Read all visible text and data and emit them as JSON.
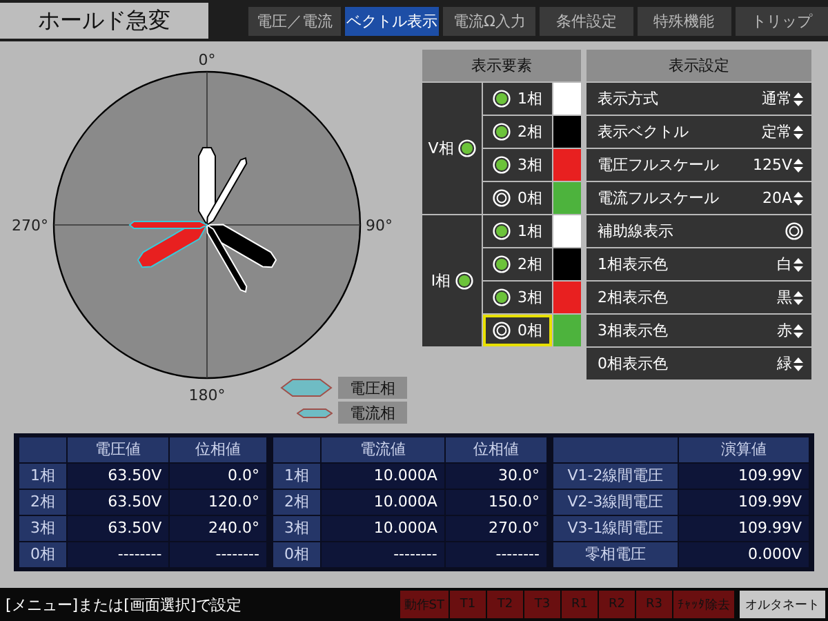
{
  "title": "ホールド急変",
  "tabs": [
    {
      "label": "電圧／電流",
      "selected": false
    },
    {
      "label": "ベクトル表示",
      "selected": true
    },
    {
      "label": "電流Ω入力",
      "selected": false
    },
    {
      "label": "条件設定",
      "selected": false
    },
    {
      "label": "特殊機能",
      "selected": false
    },
    {
      "label": "トリップ",
      "selected": false
    }
  ],
  "diagram": {
    "angle_labels": [
      "0°",
      "90°",
      "180°",
      "270°"
    ]
  },
  "legend": [
    {
      "label": "電圧相",
      "kind": "voltage"
    },
    {
      "label": "電流相",
      "kind": "current"
    }
  ],
  "display_elements": {
    "title": "表示要素",
    "groups": [
      {
        "label": "V相",
        "kind": "voltage",
        "on": true,
        "phases": [
          {
            "label": "1相",
            "on": true,
            "color": "#ffffff",
            "focused": false
          },
          {
            "label": "2相",
            "on": true,
            "color": "#000000",
            "focused": false
          },
          {
            "label": "3相",
            "on": true,
            "color": "#e82020",
            "focused": false
          },
          {
            "label": "0相",
            "on": false,
            "color": "#4db33d",
            "focused": false
          }
        ]
      },
      {
        "label": "I相",
        "kind": "current",
        "on": true,
        "phases": [
          {
            "label": "1相",
            "on": true,
            "color": "#ffffff",
            "focused": false
          },
          {
            "label": "2相",
            "on": true,
            "color": "#000000",
            "focused": false
          },
          {
            "label": "3相",
            "on": true,
            "color": "#e82020",
            "focused": false
          },
          {
            "label": "0相",
            "on": false,
            "color": "#4db33d",
            "focused": true
          }
        ]
      }
    ]
  },
  "display_settings": {
    "title": "表示設定",
    "rows": [
      {
        "label": "表示方式",
        "kind": "select",
        "value": "通常"
      },
      {
        "label": "表示ベクトル",
        "kind": "select",
        "value": "定常"
      },
      {
        "label": "電圧フルスケール",
        "kind": "select",
        "value": "125V"
      },
      {
        "label": "電流フルスケール",
        "kind": "select",
        "value": "20A"
      },
      {
        "label": "補助線表示",
        "kind": "toggle",
        "on": false
      },
      {
        "label": "1相表示色",
        "kind": "select",
        "value": "白"
      },
      {
        "label": "2相表示色",
        "kind": "select",
        "value": "黒"
      },
      {
        "label": "3相表示色",
        "kind": "select",
        "value": "赤"
      },
      {
        "label": "0相表示色",
        "kind": "select",
        "value": "緑"
      }
    ]
  },
  "voltage_table": {
    "columns": [
      "電圧値",
      "位相値"
    ],
    "rows": [
      {
        "label": "1相",
        "values": [
          "63.50V",
          "0.0°"
        ]
      },
      {
        "label": "2相",
        "values": [
          "63.50V",
          "120.0°"
        ]
      },
      {
        "label": "3相",
        "values": [
          "63.50V",
          "240.0°"
        ]
      },
      {
        "label": "0相",
        "values": [
          "--------",
          "--------"
        ]
      }
    ]
  },
  "current_table": {
    "columns": [
      "電流値",
      "位相値"
    ],
    "rows": [
      {
        "label": "1相",
        "values": [
          "10.000A",
          "30.0°"
        ]
      },
      {
        "label": "2相",
        "values": [
          "10.000A",
          "150.0°"
        ]
      },
      {
        "label": "3相",
        "values": [
          "10.000A",
          "270.0°"
        ]
      },
      {
        "label": "0相",
        "values": [
          "--------",
          "--------"
        ]
      }
    ]
  },
  "calc_table": {
    "columns": [
      "演算値"
    ],
    "rows": [
      {
        "label": "V1-2線間電圧",
        "values": [
          "109.99V"
        ]
      },
      {
        "label": "V2-3線間電圧",
        "values": [
          "109.99V"
        ]
      },
      {
        "label": "V3-1線間電圧",
        "values": [
          "109.99V"
        ]
      },
      {
        "label": "零相電圧",
        "values": [
          "0.000V"
        ]
      }
    ]
  },
  "status_text": "[メニュー]または[画面選択]で設定",
  "buttons": [
    {
      "label": "動作ST",
      "kind": "indicator"
    },
    {
      "label": "T1",
      "kind": "indicator"
    },
    {
      "label": "T2",
      "kind": "indicator"
    },
    {
      "label": "T3",
      "kind": "indicator"
    },
    {
      "label": "R1",
      "kind": "indicator"
    },
    {
      "label": "R2",
      "kind": "indicator"
    },
    {
      "label": "R3",
      "kind": "indicator"
    },
    {
      "label": "ﾁｬｯﾀ除去",
      "kind": "indicator"
    },
    {
      "label": "オルタネート",
      "kind": "toggle"
    }
  ]
}
